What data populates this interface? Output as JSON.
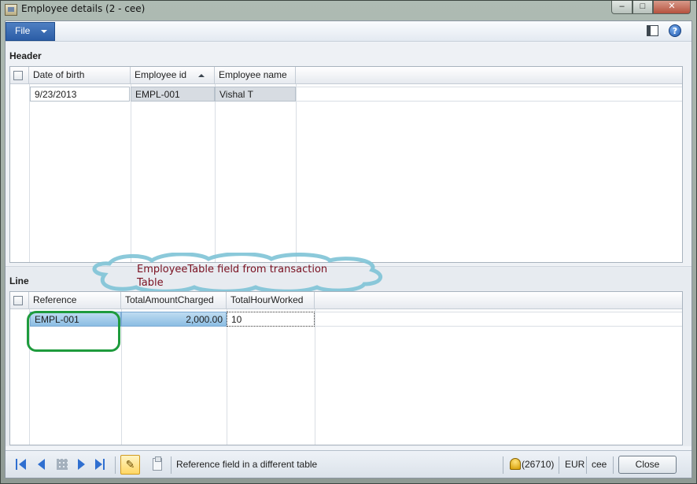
{
  "window": {
    "title": "Employee details (2 - cee)",
    "min_glyph": "–",
    "max_glyph": "□",
    "close_glyph": "✕"
  },
  "menubar": {
    "file_label": "File",
    "icons": [
      "layout-icon",
      "help-icon"
    ],
    "help_glyph": "?"
  },
  "header": {
    "section_label": "Header",
    "columns": [
      "Date of birth",
      "Employee id",
      "Employee name"
    ],
    "sorted_column": "Employee id",
    "rows": [
      {
        "date_of_birth": "9/23/2013",
        "employee_id": "EMPL-001",
        "employee_name": "Vishal T"
      }
    ]
  },
  "line": {
    "section_label": "Line",
    "columns": [
      "Reference",
      "TotalAmountCharged",
      "TotalHourWorked"
    ],
    "rows": [
      {
        "reference": "EMPL-001",
        "total_amount_charged": "2,000.00",
        "total_hour_worked": "10"
      }
    ]
  },
  "annotation": {
    "text": "EmployeeTable field from transaction Table",
    "cloud_color": "#7ec3d6",
    "ring_color": "#1e9b3d",
    "text_color": "#7a1020"
  },
  "statusbar": {
    "nav_icons": [
      "first-record-icon",
      "previous-record-icon",
      "grid-view-icon",
      "next-record-icon",
      "last-record-icon"
    ],
    "edit_glyph": "✎",
    "message": "Reference field in a different table",
    "notifications": "(26710)",
    "currency": "EUR",
    "company": "cee",
    "close_label": "Close"
  },
  "colors": {
    "accent": "#2b5da6",
    "window_frame": "#9ea9a3",
    "selected_row": "#8bbde3"
  }
}
